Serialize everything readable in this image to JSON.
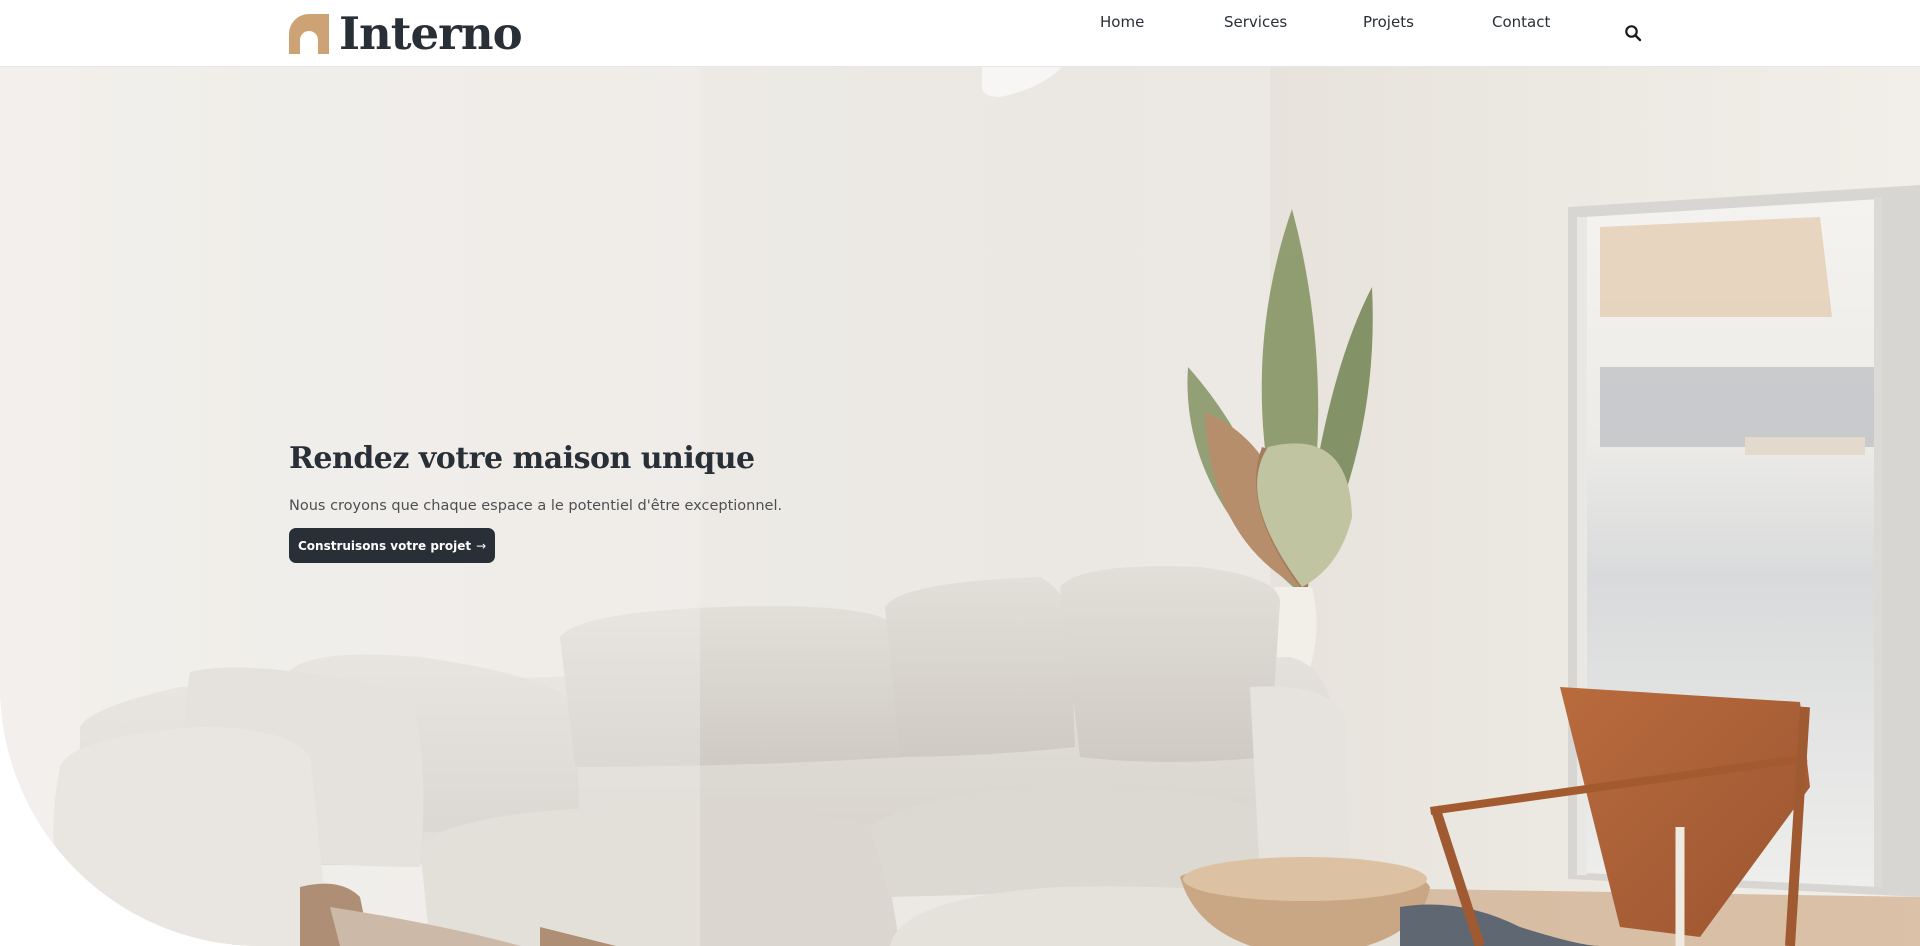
{
  "brand": {
    "name": "Interno",
    "accent_color": "#CDA274",
    "dark_color": "#292F36"
  },
  "nav": {
    "items": [
      {
        "label": "Home"
      },
      {
        "label": "Services"
      },
      {
        "label": "Projets"
      },
      {
        "label": "Contact"
      }
    ],
    "search_icon": "search-icon"
  },
  "hero": {
    "title": "Rendez votre maison unique",
    "subtitle": "Nous croyons que chaque espace a le potentiel d'être exceptionnel.",
    "cta_label": "Construisons votre projet",
    "cta_icon": "arrow-right-icon",
    "cta_arrow": "→",
    "background_image": "living-room-photo"
  }
}
